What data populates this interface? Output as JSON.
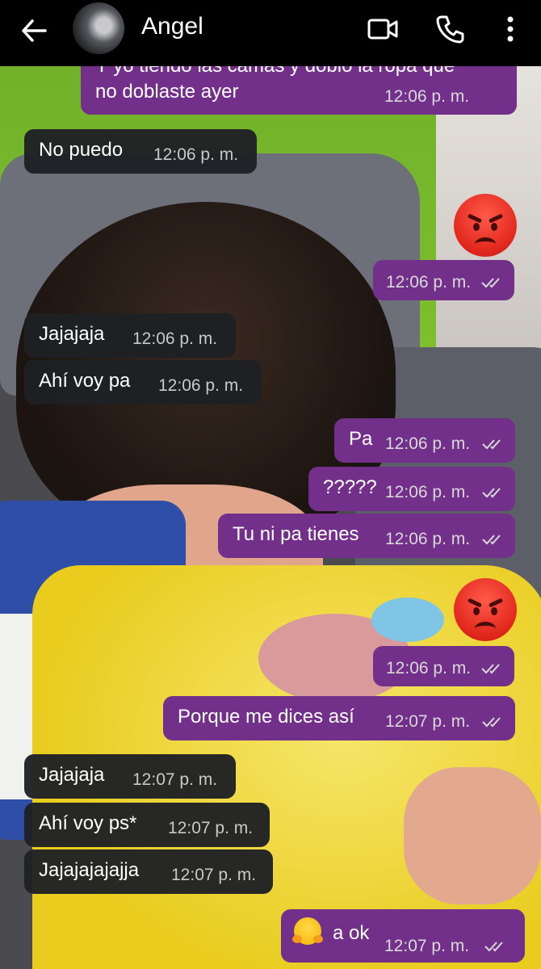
{
  "header": {
    "contact_name": "Angel",
    "icons": [
      "back-arrow-icon",
      "video-call-icon",
      "phone-icon",
      "more-options-icon"
    ]
  },
  "messages": [
    {
      "dir": "out",
      "text": "Y yo tiendo las camas y doblo la ropa que",
      "text2": "no doblaste ayer",
      "time": "12:06 p. m."
    },
    {
      "dir": "in",
      "text": "No puedo",
      "time": "12:06 p. m."
    },
    {
      "dir": "out",
      "emoji": "angry-face",
      "time": "12:06 p. m."
    },
    {
      "dir": "in",
      "text": "Jajajaja",
      "time": "12:06 p. m."
    },
    {
      "dir": "in",
      "text": "Ahí voy pa",
      "time": "12:06 p. m."
    },
    {
      "dir": "out",
      "text": "Pa",
      "time": "12:06 p. m."
    },
    {
      "dir": "out",
      "text": "?????",
      "time": "12:06 p. m."
    },
    {
      "dir": "out",
      "text": "Tu ni pa tienes",
      "time": "12:06 p. m."
    },
    {
      "dir": "out",
      "emoji": "angry-face",
      "time": "12:06 p. m."
    },
    {
      "dir": "out",
      "text": "Porque me dices así",
      "time": "12:07 p. m."
    },
    {
      "dir": "in",
      "text": "Jajajaja",
      "time": "12:07 p. m."
    },
    {
      "dir": "in",
      "text": "Ahí voy ps*",
      "time": "12:07 p. m."
    },
    {
      "dir": "in",
      "text": "Jajajajajajja",
      "time": "12:07 p. m."
    },
    {
      "dir": "out",
      "emoji": "hugging-face",
      "text": "a ok",
      "time": "12:07 p. m."
    }
  ],
  "colors": {
    "outgoing_bubble": "#73308a",
    "incoming_bubble": "#1e2024",
    "header_bg": "#000000",
    "read_ticks": "#d9d9d9"
  }
}
